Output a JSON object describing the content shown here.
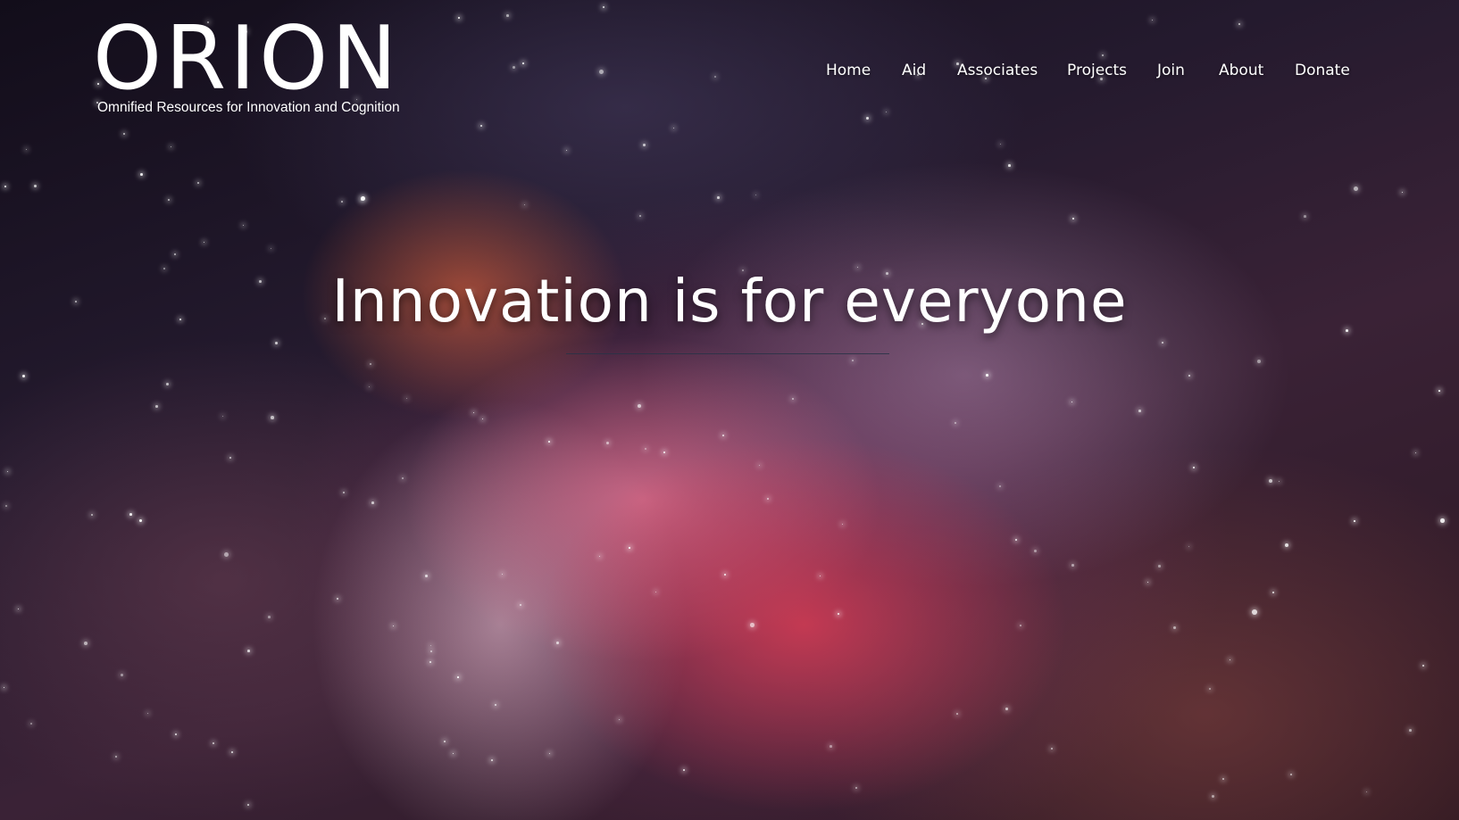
{
  "brand": {
    "name": "ORION",
    "tagline": "Omnified Resources for Innovation and Cognition"
  },
  "nav": {
    "items": [
      {
        "label": "Home"
      },
      {
        "label": "Aid"
      },
      {
        "label": "Associates"
      },
      {
        "label": "Projects"
      },
      {
        "label": "Join"
      },
      {
        "label": "About"
      },
      {
        "label": "Donate"
      }
    ]
  },
  "hero": {
    "headline": "Innovation is for everyone"
  },
  "colors": {
    "text": "#ffffff",
    "divider": "#283246"
  }
}
